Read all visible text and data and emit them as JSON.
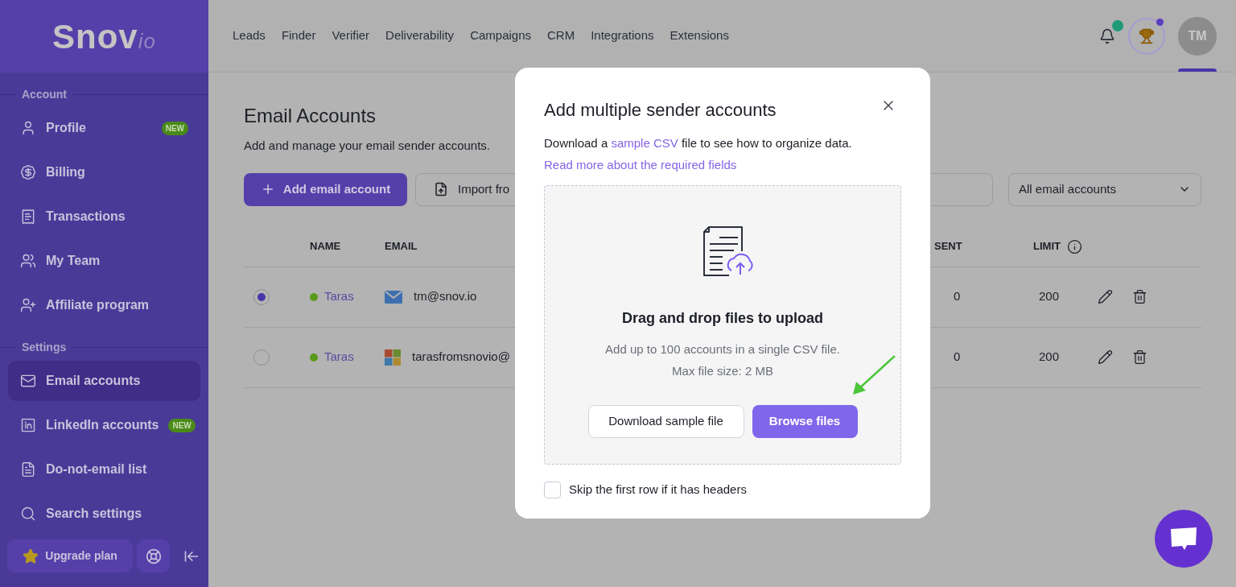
{
  "logo": {
    "text": "Snov",
    "suffix": "io"
  },
  "nav": [
    {
      "label": "Leads"
    },
    {
      "label": "Finder"
    },
    {
      "label": "Verifier"
    },
    {
      "label": "Deliverability"
    },
    {
      "label": "Campaigns"
    },
    {
      "label": "CRM"
    },
    {
      "label": "Integrations"
    },
    {
      "label": "Extensions"
    }
  ],
  "header": {
    "bell_badge": true,
    "trophy_badge": true,
    "avatar": "TM",
    "avatar_selected": true
  },
  "sidebar": {
    "sections": [
      {
        "title": "Account",
        "items": [
          {
            "label": "Profile",
            "badge": "NEW",
            "selected": false
          },
          {
            "label": "Billing",
            "selected": false
          },
          {
            "label": "Transactions",
            "selected": false
          },
          {
            "label": "My Team",
            "selected": false
          },
          {
            "label": "Affiliate program",
            "selected": false
          }
        ]
      },
      {
        "title": "Settings",
        "items": [
          {
            "label": "Email accounts",
            "selected": true
          },
          {
            "label": "LinkedIn accounts",
            "badge": "NEW",
            "selected": false
          },
          {
            "label": "Do-not-email list",
            "selected": false
          },
          {
            "label": "Search settings",
            "selected": false
          }
        ]
      }
    ],
    "upgrade": "Upgrade plan"
  },
  "page": {
    "title": "Email Accounts",
    "subtitle": "Add and manage your email sender accounts.",
    "add_button": "Add email account",
    "import_button": "Import fro",
    "filter": "All email accounts"
  },
  "table": {
    "columns": [
      "NAME",
      "EMAIL",
      "SENT",
      "LIMIT"
    ],
    "rows": [
      {
        "selected": true,
        "active": true,
        "name": "Taras",
        "kind": "envelope",
        "email": "tm@snov.io",
        "sent": "0",
        "limit": "200"
      },
      {
        "selected": false,
        "active": true,
        "name": "Taras",
        "kind": "tiles",
        "email": "tarasfromsnovio@",
        "sent": "0",
        "limit": "200"
      }
    ]
  },
  "modal": {
    "title": "Add multiple sender accounts",
    "intro_before": "Download a ",
    "intro_link": "sample CSV",
    "intro_after": " file to see how to organize data.",
    "more_link": "Read more about the required fields",
    "drop_title": "Drag and drop files to upload",
    "drop_lines": [
      "Add up to 100 accounts in a single CSV file.",
      "Max file size: 2 MB"
    ],
    "secondary_button": "Download sample file",
    "primary_button": "Browse files",
    "checkbox": {
      "label": "Skip the first row if it has headers",
      "checked": false
    }
  }
}
